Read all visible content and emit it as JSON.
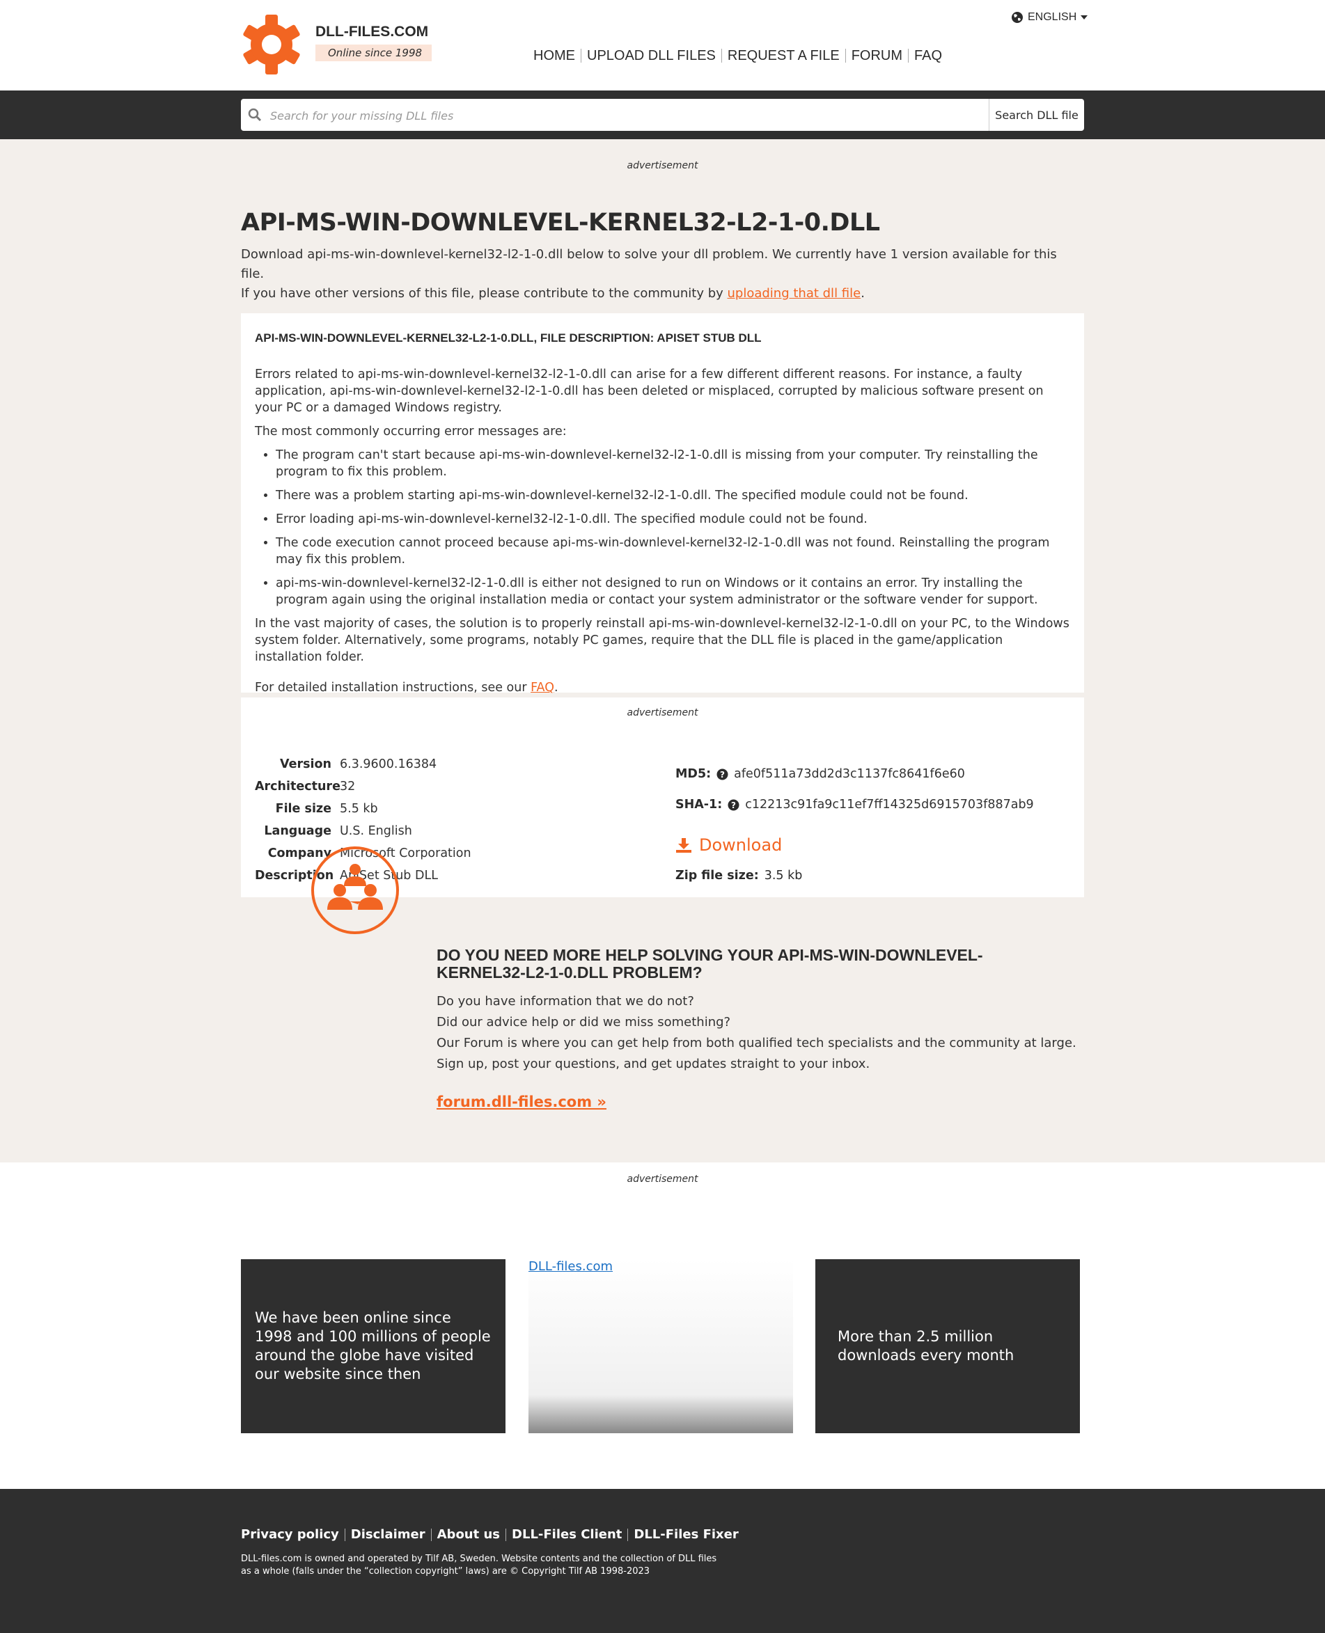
{
  "header": {
    "brand_name": "DLL-FILES.COM",
    "brand_tagline": "Online since 1998",
    "language": "ENGLISH",
    "nav": [
      "HOME",
      "UPLOAD DLL FILES",
      "REQUEST A FILE",
      "FORUM",
      "FAQ"
    ]
  },
  "search": {
    "placeholder": "Search for your missing DLL files",
    "button_label": "Search DLL file"
  },
  "ads": {
    "label": "advertisement"
  },
  "page": {
    "title": "API-MS-WIN-DOWNLEVEL-KERNEL32-L2-1-0.DLL",
    "intro_line1": "Download api-ms-win-downlevel-kernel32-l2-1-0.dll below to solve your dll problem. We currently have 1 version available for this file.",
    "intro_line2_prefix": "If you have other versions of this file, please contribute to the community by ",
    "intro_link": "uploading that dll file",
    "intro_line2_suffix": "."
  },
  "description": {
    "title": "API-MS-WIN-DOWNLEVEL-KERNEL32-L2-1-0.DLL, FILE DESCRIPTION: APISET STUB DLL",
    "para1": "Errors related to api-ms-win-downlevel-kernel32-l2-1-0.dll can arise for a few different different reasons. For instance, a faulty application, api-ms-win-downlevel-kernel32-l2-1-0.dll has been deleted or misplaced, corrupted by malicious software present on your PC or a damaged Windows registry.",
    "para2": "The most commonly occurring error messages are:",
    "errors": [
      "The program can't start because api-ms-win-downlevel-kernel32-l2-1-0.dll is missing from your computer. Try reinstalling the program to fix this problem.",
      "There was a problem starting api-ms-win-downlevel-kernel32-l2-1-0.dll. The specified module could not be found.",
      "Error loading api-ms-win-downlevel-kernel32-l2-1-0.dll. The specified module could not be found.",
      "The code execution cannot proceed because api-ms-win-downlevel-kernel32-l2-1-0.dll was not found. Reinstalling the program may fix this problem.",
      "api-ms-win-downlevel-kernel32-l2-1-0.dll is either not designed to run on Windows or it contains an error. Try installing the program again using the original installation media or contact your system administrator or the software vender for support."
    ],
    "para3": "In the vast majority of cases, the solution is to properly reinstall api-ms-win-downlevel-kernel32-l2-1-0.dll on your PC, to the Windows system folder. Alternatively, some programs, notably PC games, require that the DLL file is placed in the game/application installation folder.",
    "para4_prefix": "For detailed installation instructions, see our ",
    "para4_link": "FAQ",
    "para4_suffix": "."
  },
  "file_info": {
    "specs": [
      {
        "key": "Version",
        "value": "6.3.9600.16384"
      },
      {
        "key": "Architecture",
        "value": "32"
      },
      {
        "key": "File size",
        "value": "5.5 kb"
      },
      {
        "key": "Language",
        "value": "U.S. English"
      },
      {
        "key": "Company",
        "value": "Microsoft Corporation"
      },
      {
        "key": "Description",
        "value": "ApiSet Stub DLL"
      }
    ],
    "md5_label": "MD5:",
    "md5": "afe0f511a73dd2d3c1137fc8641f6e60",
    "sha1_label": "SHA-1:",
    "sha1": "c12213c91fa9c11ef7ff14325d6915703f887ab9",
    "download_label": "Download",
    "zip_label": "Zip file size:",
    "zip_size": "3.5 kb"
  },
  "help": {
    "title": "DO YOU NEED MORE HELP SOLVING YOUR API-MS-WIN-DOWNLEVEL-KERNEL32-L2-1-0.DLL PROBLEM?",
    "lines": [
      "Do you have information that we do not?",
      "Did our advice help or did we miss something?",
      "Our Forum is where you can get help from both qualified tech specialists and the community at large.",
      "Sign up, post your questions, and get updates straight to your inbox."
    ],
    "forum_link": "forum.dll-files.com »"
  },
  "promo": {
    "box1": "We have been online since 1998 and 100 millions of people around the globe have visited our website since then",
    "box2_link": "DLL-files.com",
    "box3": "More than 2.5 million downloads every month"
  },
  "footer": {
    "links": [
      "Privacy policy",
      "Disclaimer",
      "About us",
      "DLL-Files Client",
      "DLL-Files Fixer"
    ],
    "note": "DLL-files.com is owned and operated by Tilf AB, Sweden. Website contents and the collection of DLL files as a whole (falls under the “collection copyright” laws) are © Copyright Tilf AB 1998-2023"
  },
  "colors": {
    "accent": "#f26522",
    "dark": "#2f2f2f",
    "beige": "#f3efeb"
  }
}
